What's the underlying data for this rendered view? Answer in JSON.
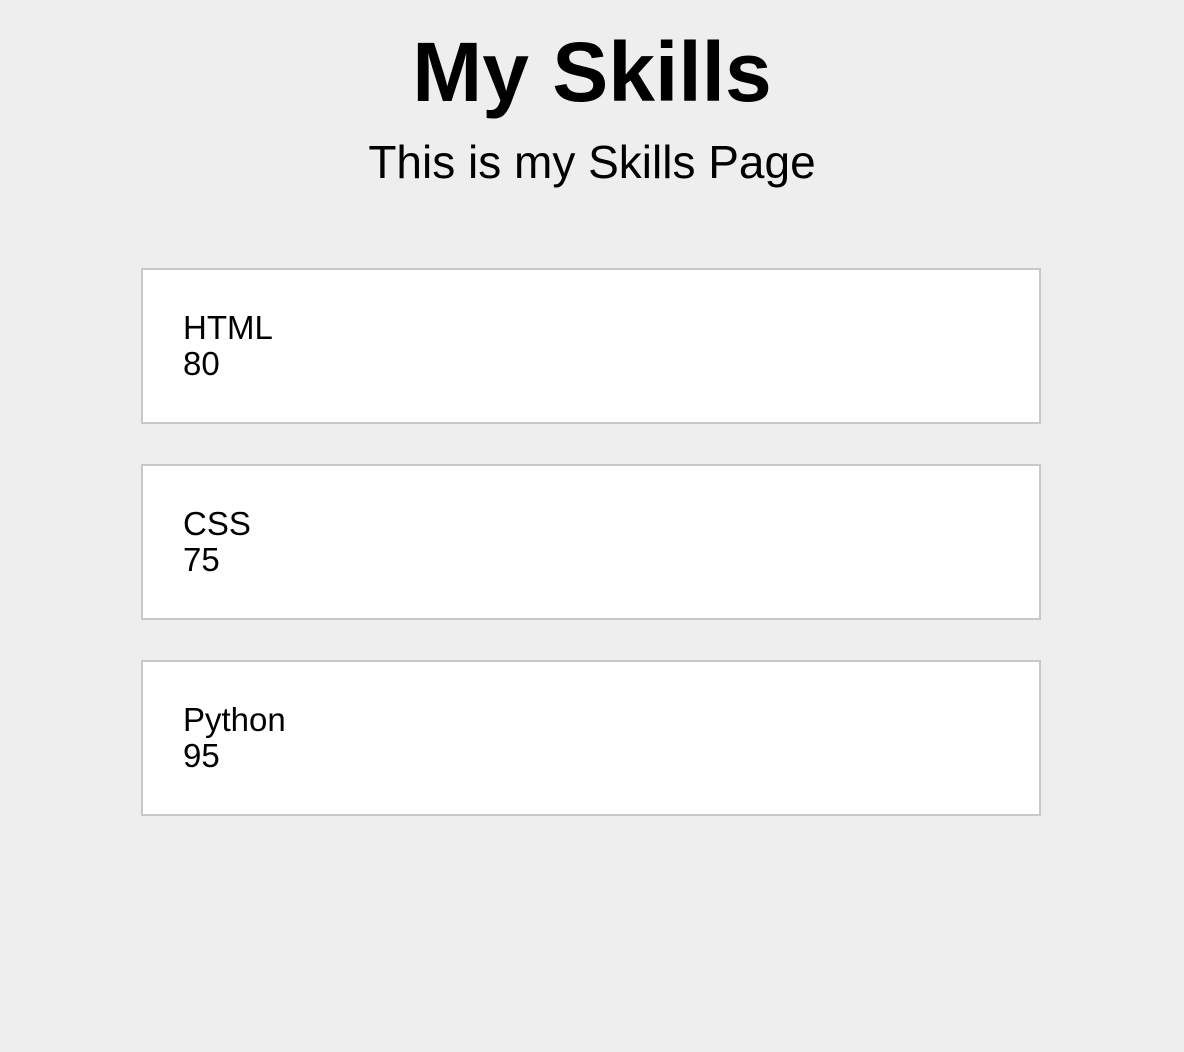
{
  "header": {
    "title": "My Skills",
    "subtitle": "This is my Skills Page"
  },
  "skills": [
    {
      "name": "HTML",
      "value": "80"
    },
    {
      "name": "CSS",
      "value": "75"
    },
    {
      "name": "Python",
      "value": "95"
    }
  ],
  "colors": {
    "background": "#eeeeee",
    "card": "#ffffff",
    "card_border": "#c8c8c8",
    "text": "#000000"
  }
}
